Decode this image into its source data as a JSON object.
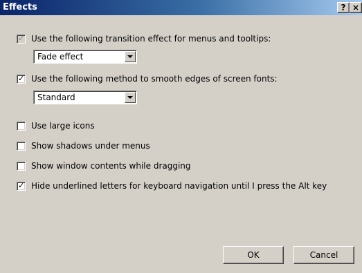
{
  "window": {
    "title": "Effects",
    "help_button": "?",
    "close_button": "×"
  },
  "options": {
    "transition_effect": {
      "label": "Use the following transition effect for menus and tooltips:",
      "checked": true,
      "disabled": true,
      "select_value": "Fade effect"
    },
    "smooth_edges": {
      "label": "Use the following method to smooth edges of screen fonts:",
      "checked": true,
      "select_value": "Standard"
    },
    "large_icons": {
      "label": "Use large icons",
      "checked": false
    },
    "menu_shadows": {
      "label": "Show shadows under menus",
      "checked": false
    },
    "window_contents_dragging": {
      "label": "Show window contents while dragging",
      "checked": false
    },
    "hide_underlined": {
      "label": "Hide underlined letters for keyboard navigation until I press the Alt key",
      "checked": true
    }
  },
  "buttons": {
    "ok": "OK",
    "cancel": "Cancel"
  },
  "colors": {
    "dialog_background": "#d4d0c8",
    "titlebar_start": "#0a246a",
    "titlebar_end": "#a6caf0"
  }
}
